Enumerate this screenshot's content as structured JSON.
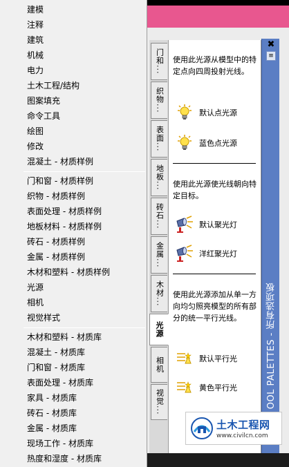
{
  "menu": {
    "group1": [
      "建模",
      "注释",
      "建筑",
      "机械",
      "电力",
      "土木工程/结构",
      "图案填充",
      "命令工具",
      "绘图",
      "修改",
      "混凝土 - 材质样例"
    ],
    "group2": [
      "门和窗 - 材质样例",
      "织物 - 材质样例",
      "表面处理 - 材质样例",
      "地板材料 - 材质样例",
      "砖石 - 材质样例",
      "金属 - 材质样例",
      "木材和塑料 - 材质样例",
      "光源",
      "相机",
      "视觉样式"
    ],
    "group3": [
      "木材和塑料 - 材质库",
      "混凝土 - 材质库",
      "门和窗 - 材质库",
      "表面处理 - 材质库",
      "家具 - 材质库",
      "砖石 - 材质库",
      "金属 - 材质库",
      "现场工作 - 材质库",
      "热度和湿度 - 材质库"
    ]
  },
  "palette": {
    "title": "TOOL PALETTES - 所有选项板",
    "title_visible": "OOL PALETTES - 所有选项板",
    "close_glyph": "✖",
    "options_glyph": "≡",
    "tabs": [
      "门和...",
      "织物...",
      "表面...",
      "地板...",
      "砖石...",
      "金属...",
      "木材...",
      "光源",
      "相机",
      "视觉..."
    ],
    "active_tab": "光源",
    "sections": [
      {
        "description": "使用此光源从模型中的特定点向四周投射光线。",
        "tools": [
          {
            "label": "默认点光源",
            "icon": "point-light-bulb-icon"
          },
          {
            "label": "蓝色点光源",
            "icon": "point-light-bulb-icon"
          }
        ]
      },
      {
        "description": "使用此光源使光线朝向特定目标。",
        "tools": [
          {
            "label": "默认聚光灯",
            "icon": "spotlight-icon"
          },
          {
            "label": "洋红聚光灯",
            "icon": "spotlight-icon"
          }
        ]
      },
      {
        "description": "使用此光源添加从单一方向均匀照亮模型的所有部分的统一平行光线。",
        "tools": [
          {
            "label": "默认平行光",
            "icon": "distant-light-icon"
          },
          {
            "label": "黄色平行光",
            "icon": "distant-light-icon"
          }
        ]
      }
    ]
  },
  "watermark": {
    "name": "土木工程网",
    "url": "www.civilcn.com"
  },
  "colors": {
    "titlebar": "#5b7ec4",
    "pink_background": "#e8578f",
    "menu_background": "#f0f0f0"
  }
}
